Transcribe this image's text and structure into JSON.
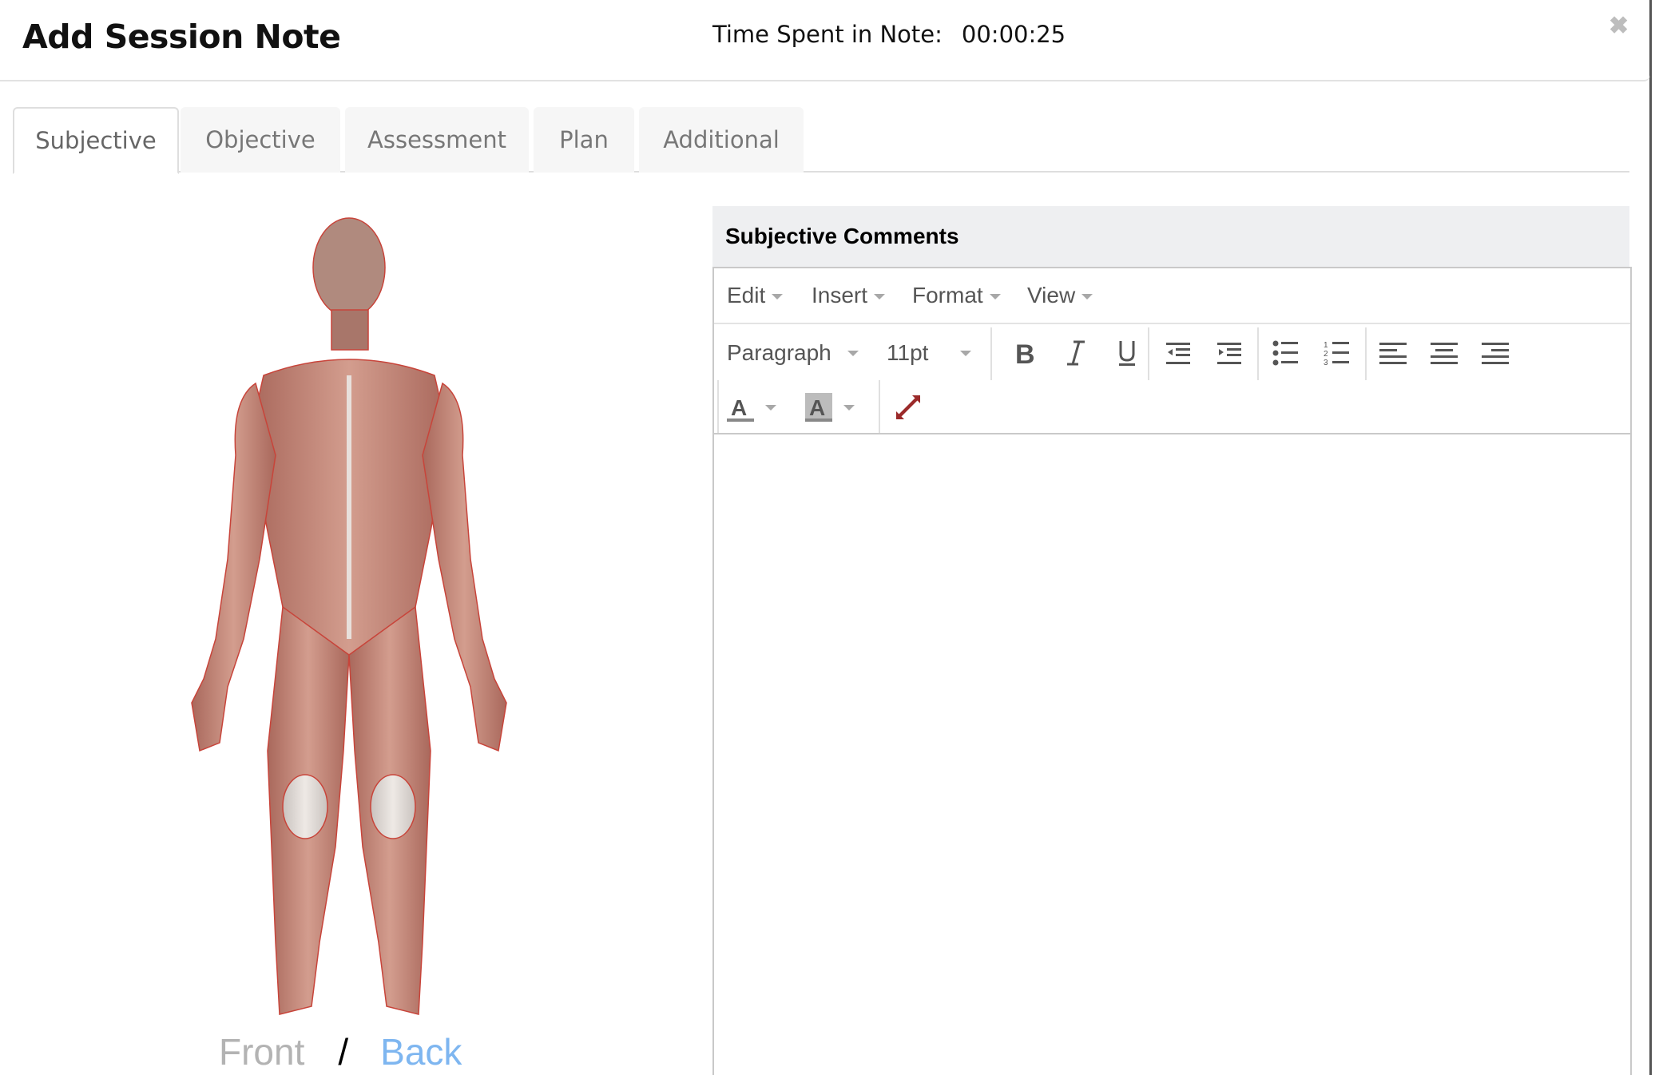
{
  "modal": {
    "title": "Add Session Note",
    "timer_label": "Time Spent in Note:",
    "timer_value": "00:00:25",
    "close_icon": "close-x-icon"
  },
  "tabs": [
    {
      "label": "Subjective",
      "active": true
    },
    {
      "label": "Objective",
      "active": false
    },
    {
      "label": "Assessment",
      "active": false
    },
    {
      "label": "Plan",
      "active": false
    },
    {
      "label": "Additional",
      "active": false
    }
  ],
  "body_diagram": {
    "image": "muscular-anatomy-front-figure",
    "front_label": "Front",
    "separator": "/",
    "back_label": "Back",
    "active_view": "Front"
  },
  "comments": {
    "heading": "Subjective Comments",
    "menus": [
      "Edit",
      "Insert",
      "Format",
      "View"
    ],
    "block_format": "Paragraph",
    "font_size": "11pt",
    "toolbar_icons": [
      "bold-icon",
      "italic-icon",
      "underline-icon",
      "outdent-icon",
      "indent-icon",
      "bullet-list-icon",
      "numbered-list-icon",
      "align-left-icon",
      "align-center-icon",
      "align-right-icon",
      "text-color-icon",
      "background-color-icon",
      "fullscreen-icon"
    ],
    "content": "",
    "colors": {
      "fullscreen": "#9b2a2a",
      "back_link": "#7eb6f0",
      "front_link": "#b3b3b3"
    }
  }
}
